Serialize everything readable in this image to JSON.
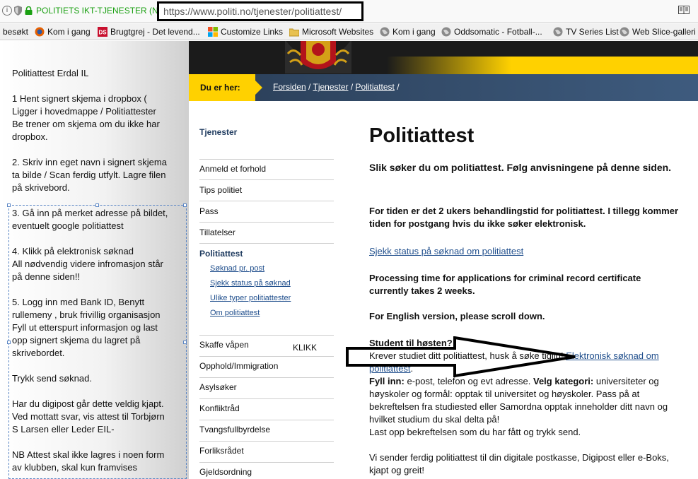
{
  "browser": {
    "site_identity": "POLITIETS IKT-TJENESTER (NO)",
    "url": "https://www.politi.no/tjenester/politiattest/",
    "bookmarks": [
      {
        "label": "besøkt",
        "icon": "none"
      },
      {
        "label": "Kom i gang",
        "icon": "firefox-icon"
      },
      {
        "label": "Brugtgrej - Det levend...",
        "icon": "ds-icon"
      },
      {
        "label": "Customize Links",
        "icon": "windows-icon"
      },
      {
        "label": "Microsoft Websites",
        "icon": "folder-icon"
      },
      {
        "label": "Kom i gang",
        "icon": "globe-icon"
      },
      {
        "label": "Oddsomatic - Fotball-...",
        "icon": "globe-icon"
      },
      {
        "label": "TV Series List",
        "icon": "globe-icon"
      },
      {
        "label": "Web Slice-galleri",
        "icon": "globe-icon"
      }
    ]
  },
  "notes": {
    "title": "Politiattest Erdal IL",
    "step1": "1 Hent signert skjema i dropbox (\nLigger i hovedmappe / Politiattester\nBe trener om skjema om du ikke har\ndropbox.",
    "step2": "2. Skriv inn eget navn i signert skjema\nta bilde / Scan ferdig utfylt. Lagre filen\npå skrivebord.",
    "step3": "3. Gå inn på merket adresse på bildet,\neventuelt google politiattest",
    "step4": "4. Klikk på elektronisk søknad\nAll nødvendig videre infromasjon står\npå denne siden!!",
    "step5": "5. Logg inn med Bank ID, Benytt\nrullemeny , bruk frivillig organisasjon\nFyll ut etterspurt informasjon og last\nopp signert skjema du lagret på\nskrivebordet.",
    "send": "Trykk send søknad.",
    "digipost": "Har du digipost går dette veldig kjapt.\nVed mottatt svar, vis attest til Torbjørn\nS Larsen eller Leder EIL-",
    "nb": "NB Attest skal ikke lagres i noen form\nav klubben, skal kun framvises"
  },
  "breadcrumb": {
    "label": "Du er her:",
    "items": [
      "Forsiden",
      "Tjenester",
      "Politiattest"
    ]
  },
  "nav": {
    "heading": "Tjenester",
    "items": [
      "Anmeld et forhold",
      "Tips politiet",
      "Pass",
      "Tillatelser",
      "Politiattest"
    ],
    "sub_items": [
      "Søknad pr. post",
      "Sjekk status på søknad",
      "Ulike typer politiattester",
      "Om politiattest"
    ],
    "items_after": [
      "Skaffe våpen",
      "Opphold/Immigration",
      "Asylsøker",
      "Konfliktråd",
      "Tvangsfullbyrdelse",
      "Forliksrådet",
      "Gjeldsordning"
    ],
    "klikk": "KLIKK"
  },
  "main": {
    "title": "Politiattest",
    "intro": "Slik søker du om politiattest. Følg anvisningene på denne siden.",
    "notice": "For tiden er det 2 ukers behandlingstid for politiattest. I tillegg kommer tiden for postgang hvis du ikke søker elektronisk.",
    "status_link": "Sjekk status på søknad om politiattest",
    "processing": "Processing time for applications for criminal record certificate currently takes 2 weeks.",
    "english": "For English version, please scroll down.",
    "student_heading": "Student til høsten?",
    "student_text": "Krever studiet ditt politiattest, husk å søke tidlig!",
    "student_link": "Elektronisk søknad om politiattest",
    "student_text_end": ".",
    "fill_label": "Fyll inn:",
    "fill_text": "e-post, telefon og evt adresse.",
    "category_label": "Velg kategori:",
    "category_text": "universiteter og høyskoler og formål: opptak til universitet og høyskoler. Pass på at bekreftelsen fra studiested eller Samordna opptak inneholder ditt navn og hvilket studium du skal delta på!",
    "upload_text": "Last opp bekreftelsen som du har fått og trykk send.",
    "digital_text": "Vi sender ferdig politiattest til din digitale postkasse, Digipost eller e-Boks, kjapt og greit!"
  },
  "colors": {
    "yellow": "#ffd100",
    "navy": "#2a3e57",
    "link": "#1f4e8c",
    "secure_green": "#1aa012"
  }
}
